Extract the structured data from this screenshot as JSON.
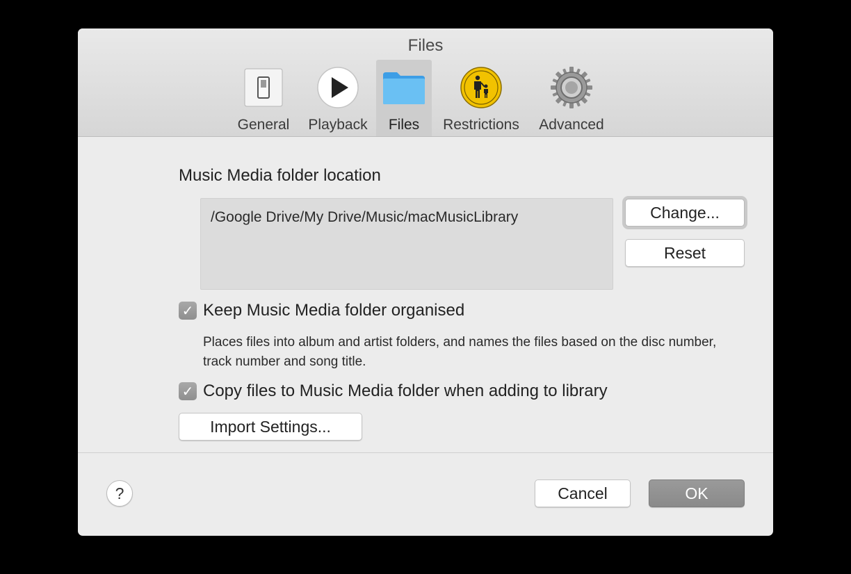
{
  "window": {
    "title": "Files"
  },
  "tabs": [
    {
      "label": "General",
      "icon": "switch-icon"
    },
    {
      "label": "Playback",
      "icon": "play-icon"
    },
    {
      "label": "Files",
      "icon": "folder-icon",
      "active": true
    },
    {
      "label": "Restrictions",
      "icon": "parental-controls-icon"
    },
    {
      "label": "Advanced",
      "icon": "gear-icon"
    }
  ],
  "media_folder": {
    "title": "Music Media folder location",
    "path": "/Google Drive/My Drive/Music/macMusicLibrary",
    "change_label": "Change...",
    "reset_label": "Reset"
  },
  "options": {
    "keep_organised": {
      "label": "Keep Music Media folder organised",
      "checked": true,
      "description": "Places files into album and artist folders, and names the files based on the disc number, track number and song title."
    },
    "copy_files": {
      "label": "Copy files to Music Media folder when adding to library",
      "checked": true
    },
    "checkmark": "✓",
    "import_settings_label": "Import Settings..."
  },
  "footer": {
    "help_label": "?",
    "cancel_label": "Cancel",
    "ok_label": "OK"
  },
  "colors": {
    "folder": "#5ab6ef",
    "restrictions": "#f2c200",
    "ok_button": "#8f8f8f"
  }
}
